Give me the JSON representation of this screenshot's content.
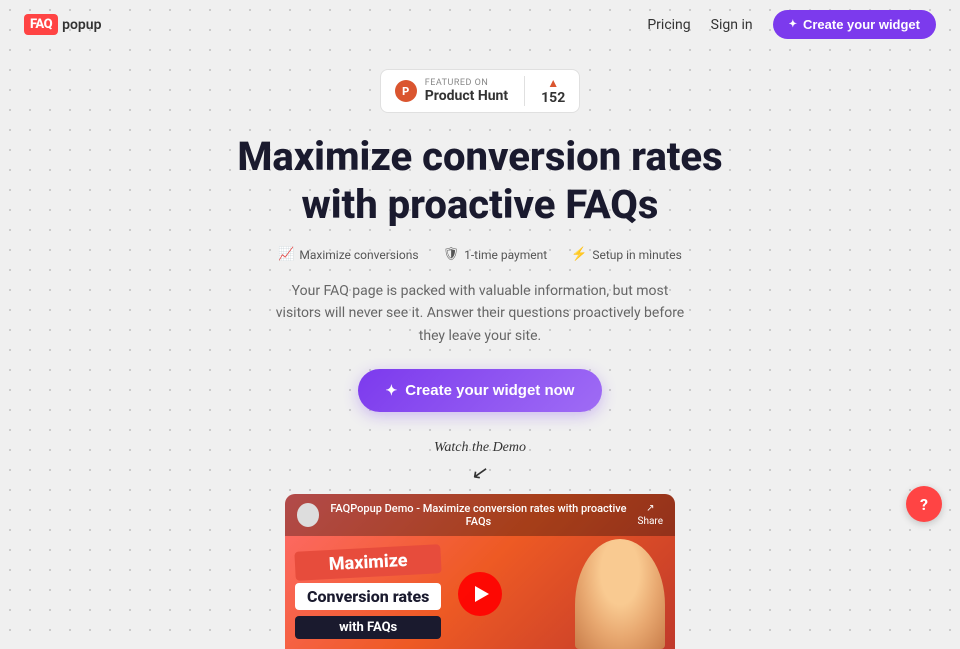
{
  "nav": {
    "logo_text": "FAQ",
    "logo_suffix": "popup",
    "pricing_label": "Pricing",
    "signin_label": "Sign in",
    "create_widget_label": "Create your widget"
  },
  "product_hunt": {
    "featured_label": "FEATURED ON",
    "name": "Product Hunt",
    "count": "152",
    "arrow": "▲"
  },
  "hero": {
    "headline_line1": "Maximize conversion rates",
    "headline_line2": "with proactive FAQs",
    "feature1_icon": "📈",
    "feature1_label": "Maximize conversions",
    "feature2_icon": "🛡",
    "feature2_label": "1-time payment",
    "feature3_icon": "⚡",
    "feature3_label": "Setup in minutes",
    "subtext": "Your FAQ page is packed with valuable information, but most visitors will never see it. Answer their questions proactively before they leave your site.",
    "cta_label": "Create your widget now",
    "watch_demo_label": "Watch the Demo"
  },
  "video": {
    "title": "FAQPopup Demo - Maximize conversion rates with proactive FAQs",
    "share_label": "Share",
    "badge1": "Maximize",
    "badge2": "Conversion rates",
    "badge3": "with FAQs"
  },
  "help": {
    "label": "?"
  }
}
